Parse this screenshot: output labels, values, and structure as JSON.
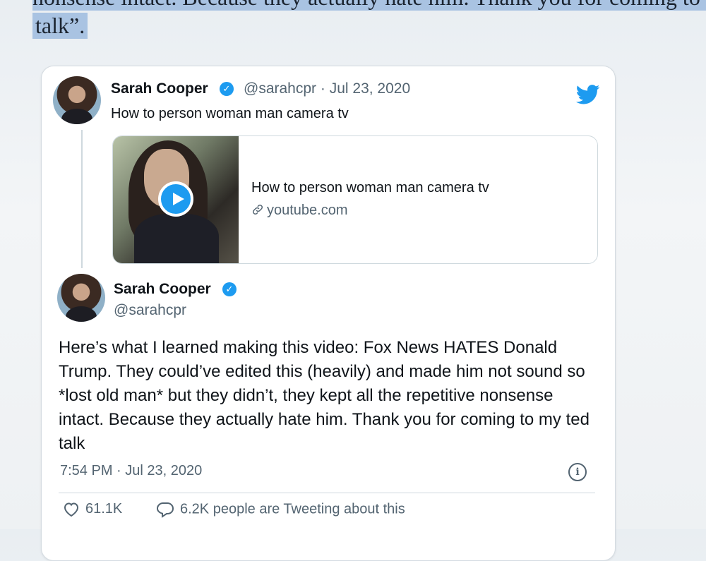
{
  "top_quote": {
    "line1": "nonsense intact. Because they actually hate him. Thank you for coming to my ted",
    "line2": "talk”."
  },
  "quoted_tweet": {
    "author_name": "Sarah Cooper",
    "handle": "@sarahcpr",
    "separator": "·",
    "date": "Jul 23, 2020",
    "text": "How to person woman man camera tv",
    "link_card": {
      "title": "How to person woman man camera tv",
      "domain": "youtube.com"
    }
  },
  "main_tweet": {
    "author_name": "Sarah Cooper",
    "handle": "@sarahcpr",
    "text": "Here’s what I learned making this video: Fox News HATES Donald Trump. They could’ve edited this (heavily) and made him not sound so *lost old man* but they didn’t, they kept all the repetitive nonsense intact. Because they actually hate him. Thank you for coming to my ted talk",
    "timestamp": "7:54 PM · Jul 23, 2020",
    "likes": "61.1K",
    "tweeting_about": "6.2K people are Tweeting about this"
  },
  "colors": {
    "accent": "#1d9bf0",
    "text": "#0f1419",
    "muted": "#536471",
    "highlight": "#a9c3e2"
  },
  "icons": [
    "verified-badge-icon",
    "twitter-bird-icon",
    "play-icon",
    "link-icon",
    "info-icon",
    "heart-icon",
    "reply-bubble-icon"
  ]
}
